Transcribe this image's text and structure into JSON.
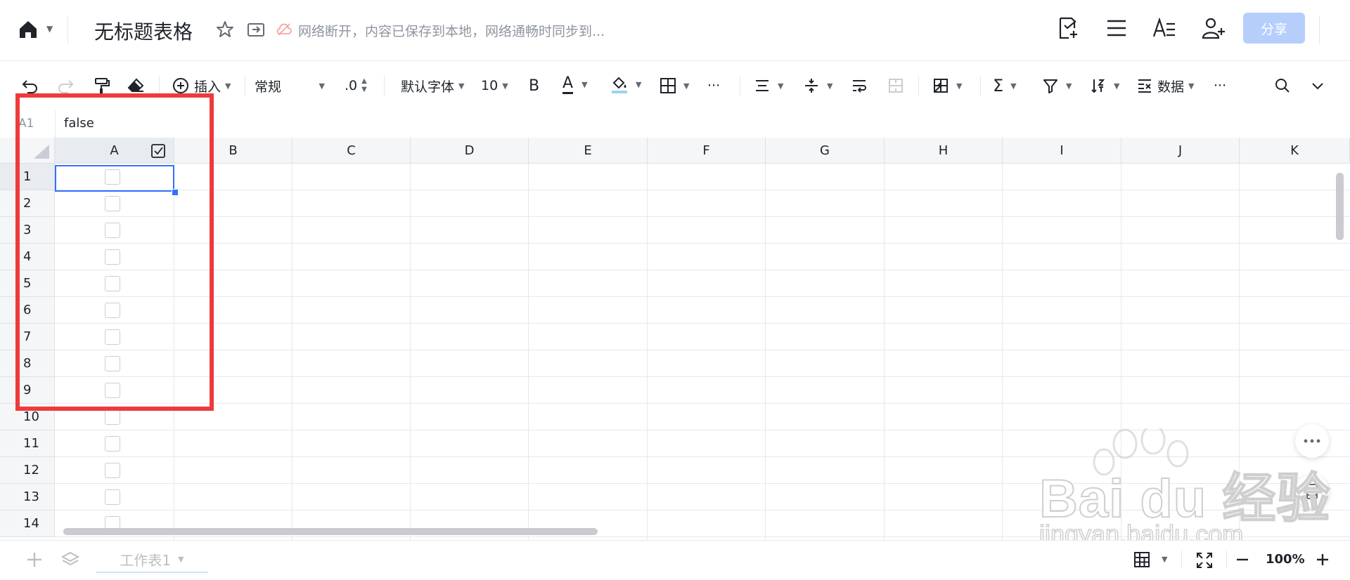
{
  "header": {
    "title": "无标题表格",
    "status_text": "网络断开，内容已保存到本地，网络通畅时同步到...",
    "share_label": "分享"
  },
  "toolbar": {
    "insert_label": "插入",
    "format_label": "常规",
    "decimal_label": ".0",
    "font_label": "默认字体",
    "font_size": "10",
    "bold_label": "B",
    "text_color_label": "A",
    "data_label": "数据",
    "more_label": "···",
    "more2_label": "···"
  },
  "formula_bar": {
    "cell_ref": "A1",
    "value": "false"
  },
  "grid": {
    "columns": [
      "A",
      "B",
      "C",
      "D",
      "E",
      "F",
      "G",
      "H",
      "I",
      "J",
      "K"
    ],
    "rows": [
      "1",
      "2",
      "3",
      "4",
      "5",
      "6",
      "7",
      "8",
      "9",
      "10",
      "11",
      "12",
      "13",
      "14"
    ]
  },
  "bottom": {
    "sheet_tab": "工作表1",
    "zoom": "100%"
  },
  "watermark": {
    "line1": "Bai du 经验",
    "line2": "jingyan.baidu.com"
  },
  "colors": {
    "accent": "#3370ff",
    "highlight_box": "#ee3a3a",
    "share_button": "#b6cefc"
  }
}
